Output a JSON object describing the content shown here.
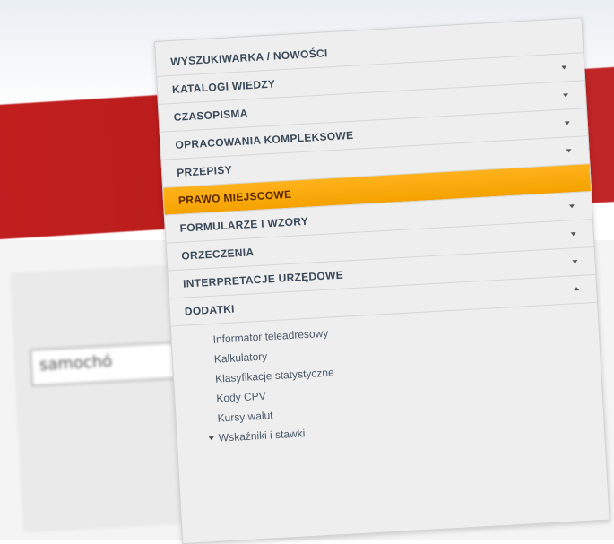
{
  "menu": {
    "items": [
      {
        "label": "WYSZUKIWARKA / NOWOŚCI"
      },
      {
        "label": "KATALOGI WIEDZY"
      },
      {
        "label": "CZASOPISMA"
      },
      {
        "label": "OPRACOWANIA KOMPLEKSOWE"
      },
      {
        "label": "PRZEPISY"
      },
      {
        "label": "PRAWO MIEJSCOWE"
      },
      {
        "label": "FORMULARZE I WZORY"
      },
      {
        "label": "ORZECZENIA"
      },
      {
        "label": "INTERPRETACJE URZĘDOWE"
      },
      {
        "label": "DODATKI"
      }
    ],
    "active_item": "PRAWO MIEJSCOWE",
    "subitems": [
      {
        "label": "Informator teleadresowy"
      },
      {
        "label": "Kalkulatory"
      },
      {
        "label": "Klasyfikacje statystyczne"
      },
      {
        "label": "Kody CPV"
      },
      {
        "label": "Kursy walut"
      },
      {
        "label": "Wskaźniki i stawki"
      }
    ]
  },
  "background": {
    "search_value": "samochó"
  },
  "colors": {
    "active": "#f5a200",
    "brand_red": "#c21f1f",
    "menu_bg": "#eeeeee",
    "menu_text": "#3a4a5a"
  }
}
